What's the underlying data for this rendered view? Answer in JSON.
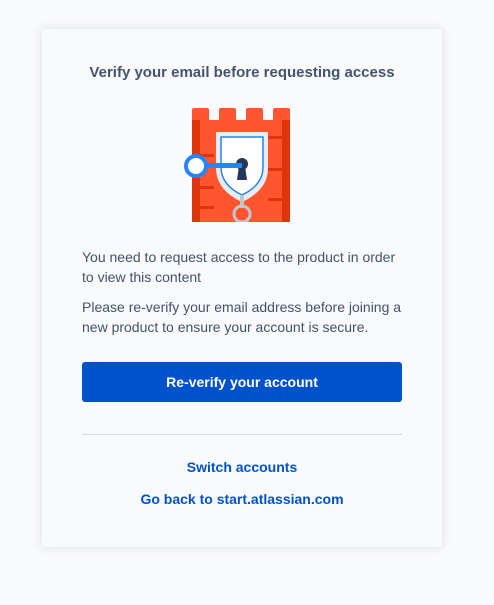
{
  "dialog": {
    "title": "Verify your email before requesting access",
    "illustration_icon": "locked-castle-with-key-icon",
    "message_1": "You need to request access to the product in order to view this content",
    "message_2": "Please re-verify your email address before joining a new product to ensure your account is secure.",
    "primary_button": "Re-verify your account",
    "link_switch": "Switch accounts",
    "link_back": "Go back to start.atlassian.com"
  },
  "colors": {
    "primary": "#0052cc",
    "castle": "#ff5630",
    "key": "#2684ff"
  }
}
